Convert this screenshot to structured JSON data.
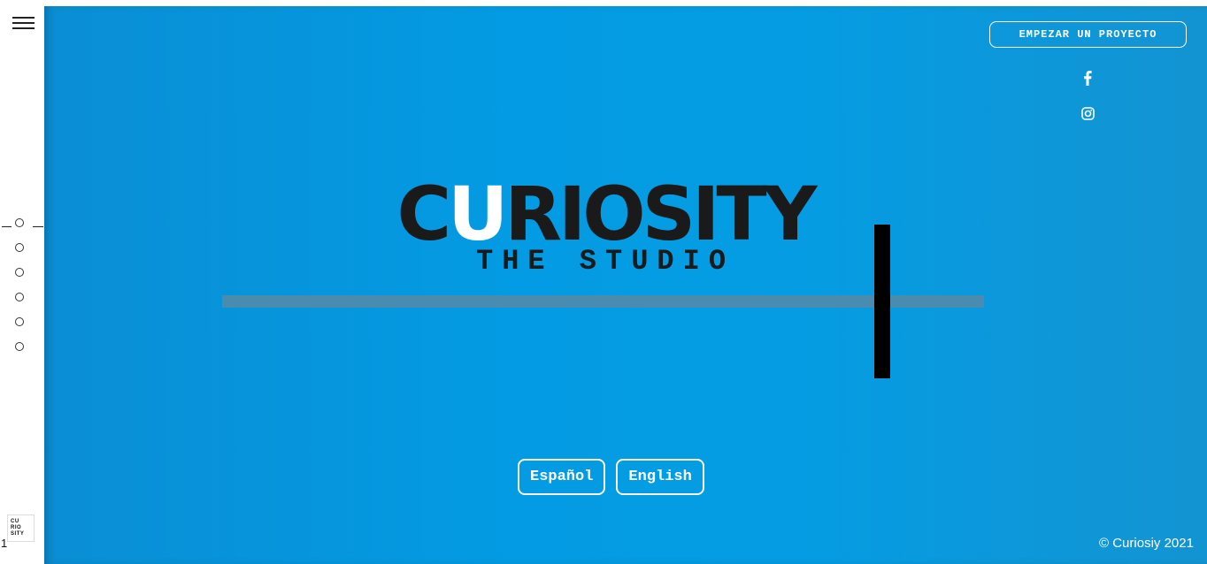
{
  "sidebar": {
    "menu_icon": "hamburger-menu-icon",
    "nav_dots_count": 6,
    "logo_lines": [
      "CU",
      "RIO",
      "SITY"
    ],
    "page_number": "1"
  },
  "header": {
    "cta_label": "EMPEZAR UN PROYECTO",
    "social": [
      {
        "icon": "facebook-icon"
      },
      {
        "icon": "instagram-icon"
      }
    ]
  },
  "brand": {
    "title_prefix": "C",
    "title_highlight": "U",
    "title_suffix": "RIOSITY",
    "subtitle": "THE STUDIO"
  },
  "languages": {
    "spanish": "Español",
    "english": "English"
  },
  "footer": {
    "copyright": "© Curiosiy 2021"
  },
  "colors": {
    "hero_blue": "#039be3",
    "text_dark": "#1a1a1a",
    "white": "#ffffff"
  }
}
